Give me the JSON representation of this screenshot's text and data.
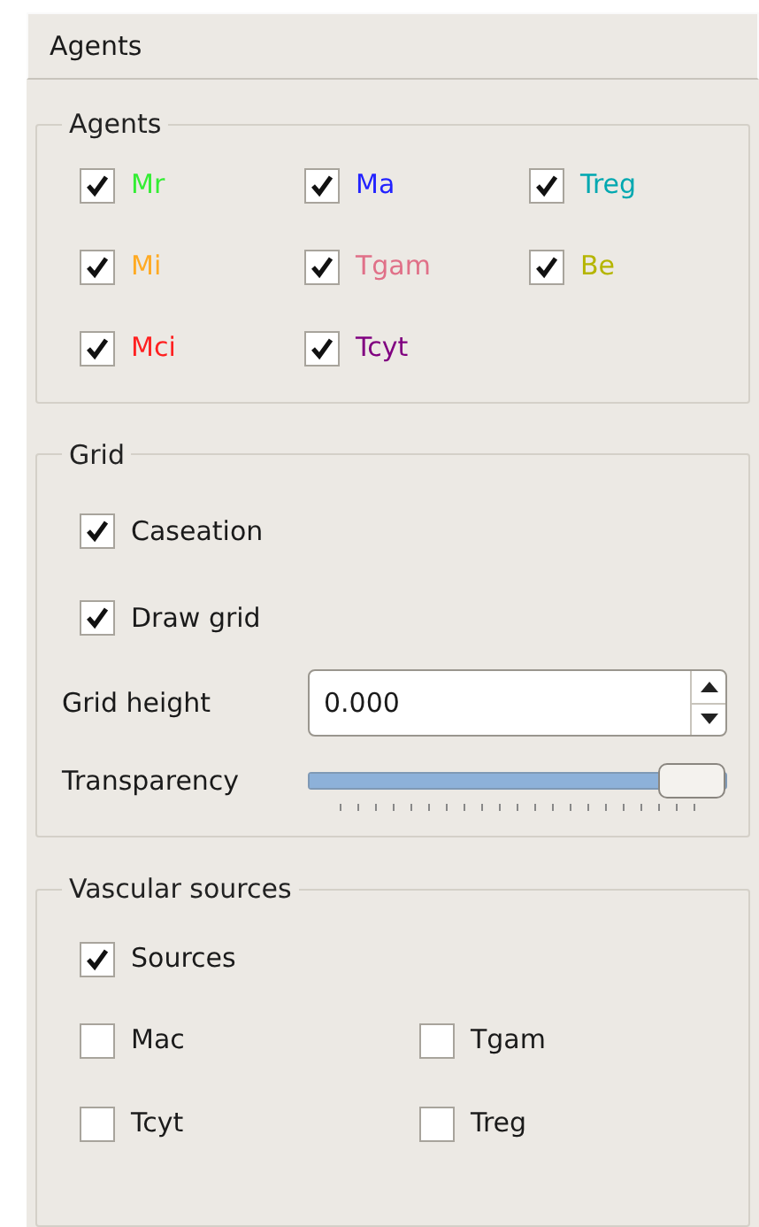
{
  "header": {
    "title": "Agents"
  },
  "agents": {
    "title": "Agents",
    "items": [
      {
        "label": "Mr",
        "checked": true,
        "color": "#33ee33"
      },
      {
        "label": "Ma",
        "checked": true,
        "color": "#2222ff"
      },
      {
        "label": "Treg",
        "checked": true,
        "color": "#00a8b0"
      },
      {
        "label": "Mi",
        "checked": true,
        "color": "#ffaa22"
      },
      {
        "label": "Tgam",
        "checked": true,
        "color": "#e07088"
      },
      {
        "label": "Be",
        "checked": true,
        "color": "#b5b500"
      },
      {
        "label": "Mci",
        "checked": true,
        "color": "#ff2020"
      },
      {
        "label": "Tcyt",
        "checked": true,
        "color": "#800080"
      }
    ]
  },
  "grid": {
    "title": "Grid",
    "caseation": {
      "label": "Caseation",
      "checked": true
    },
    "draw_grid": {
      "label": "Draw grid",
      "checked": true
    },
    "grid_height": {
      "label": "Grid height",
      "value": "0.000"
    },
    "transparency": {
      "label": "Transparency",
      "level": 1
    }
  },
  "vascular": {
    "title": "Vascular sources",
    "sources": {
      "label": "Sources",
      "checked": true
    },
    "items": [
      {
        "label": "Mac",
        "checked": false
      },
      {
        "label": "Tgam",
        "checked": false
      },
      {
        "label": "Tcyt",
        "checked": false
      },
      {
        "label": "Treg",
        "checked": false
      }
    ]
  }
}
